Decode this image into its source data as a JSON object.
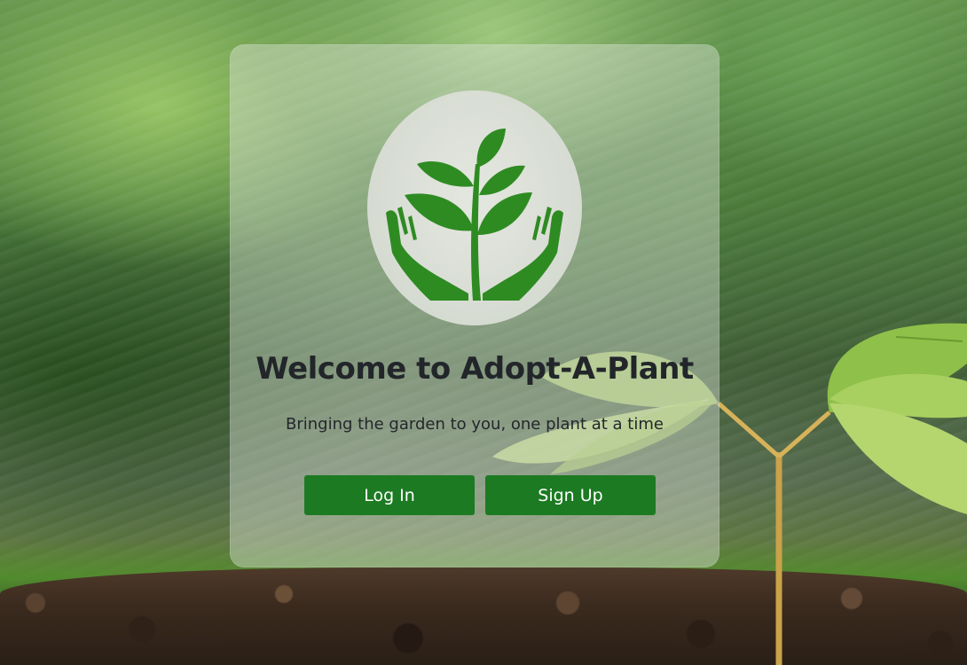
{
  "app": {
    "title": "Welcome to Adopt-A-Plant",
    "tagline": "Bringing the garden to you, one plant at a time"
  },
  "logo": {
    "icon": "hands-holding-plant-icon",
    "color": "#2e8b22",
    "background": "#dfe3da"
  },
  "actions": {
    "login_label": "Log In",
    "signup_label": "Sign Up",
    "button_color": "#1c7a22"
  }
}
